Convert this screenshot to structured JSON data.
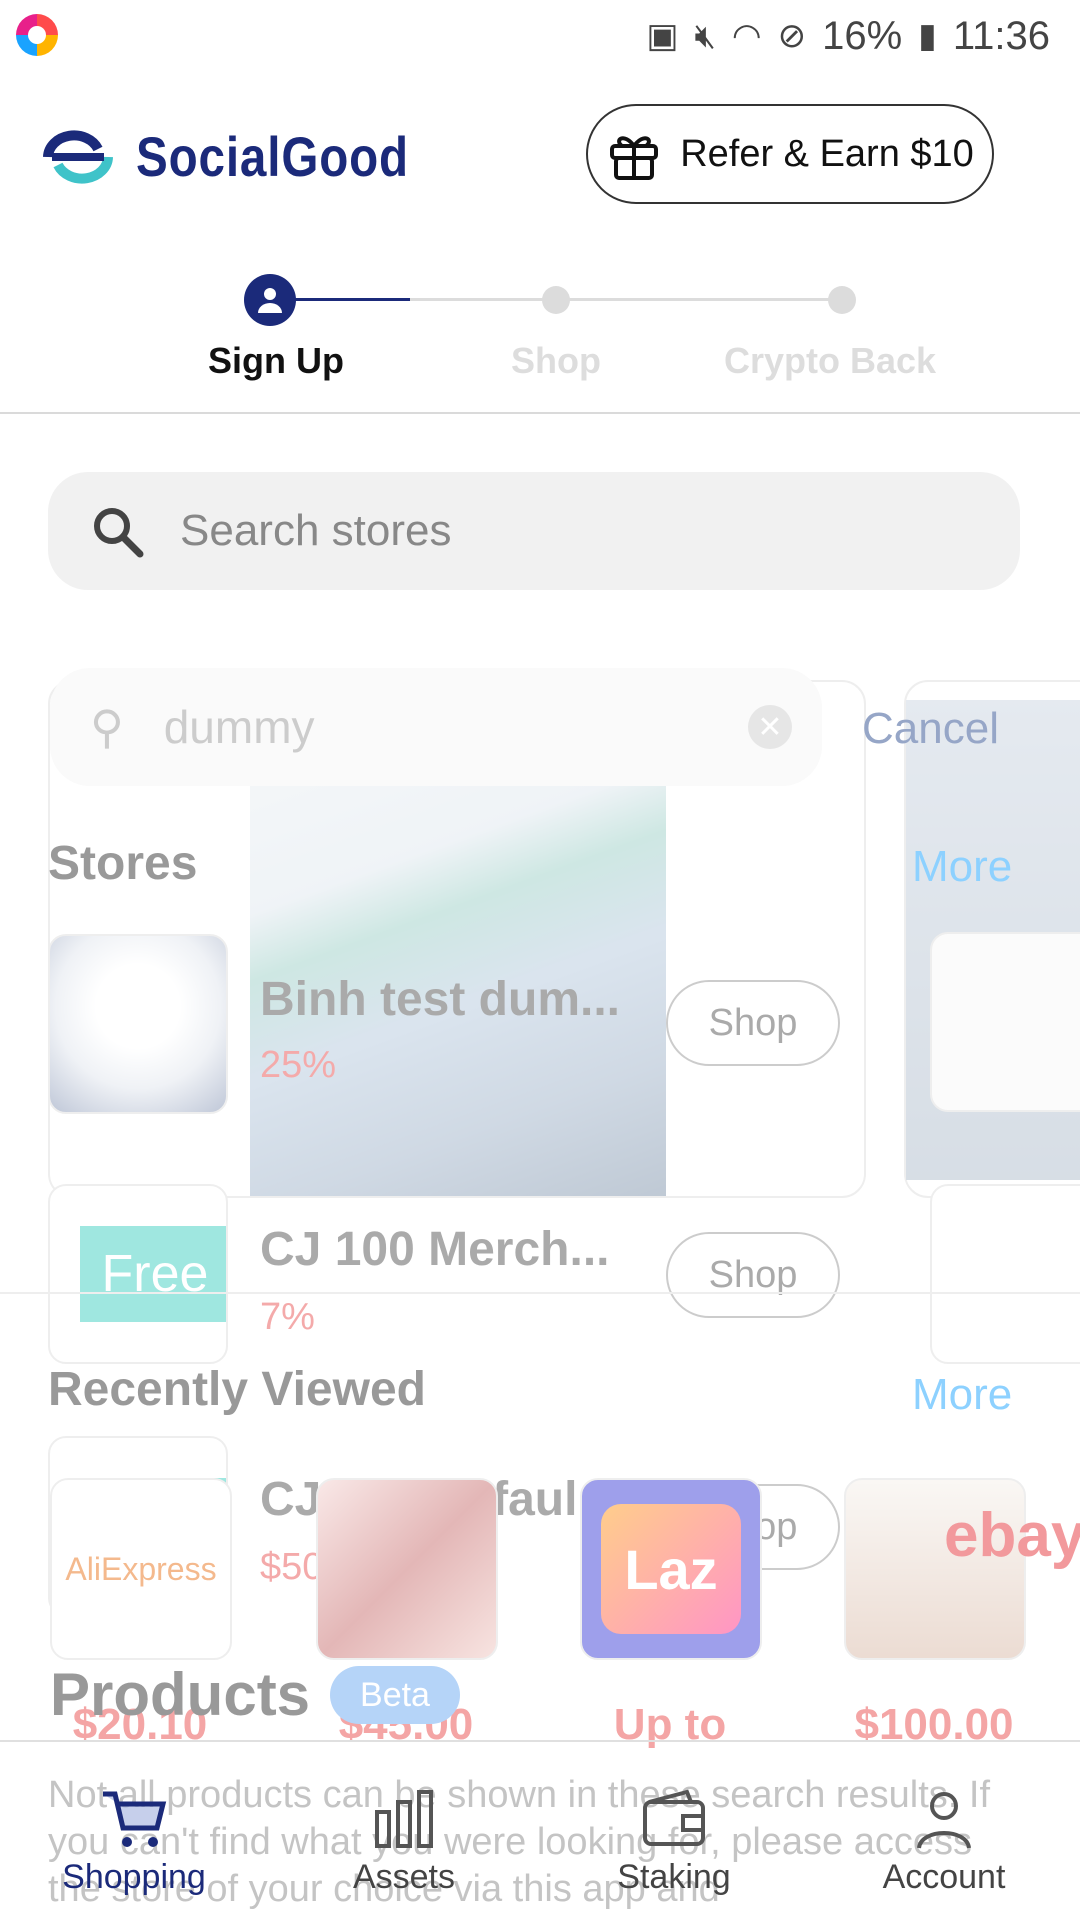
{
  "status_bar": {
    "battery": "16%",
    "time": "11:36"
  },
  "header": {
    "brand": "SocialGood",
    "refer_label": "Refer & Earn $10"
  },
  "stepper": {
    "steps": [
      {
        "label": "Sign Up"
      },
      {
        "label": "Shop"
      },
      {
        "label": "Crypto Back"
      }
    ]
  },
  "search": {
    "placeholder": "Search stores"
  },
  "overlay": {
    "query": "dummy",
    "cancel": "Cancel",
    "stores_title": "Stores",
    "more": "More",
    "stores": [
      {
        "name": "Binh test dum...",
        "rate": "25%",
        "shop": "Shop"
      },
      {
        "name": "CJ 100 Merch...",
        "rate": "7%",
        "shop": "Shop"
      },
      {
        "name": "CJ Eba defaul...",
        "rate": "$50.00",
        "shop": "Shop"
      }
    ],
    "recently_viewed_title": "Recently Viewed",
    "recently_more": "More",
    "recent_products": [
      {
        "logo": "AliExpress",
        "price": "$20.10"
      },
      {
        "price": "$45.00"
      },
      {
        "logo": "Laz",
        "price": "Up to"
      },
      {
        "price": "$100.00"
      }
    ],
    "free_badge": "Free",
    "ebay_logo": "ebay",
    "products_title": "Products",
    "beta": "Beta",
    "note": "Not all products can be shown in these search results. If you can't find what you were looking for, please access the store of your choice via this app and"
  },
  "nav": [
    {
      "label": "Shopping",
      "icon": "cart-icon",
      "active": true
    },
    {
      "label": "Assets",
      "icon": "bar-chart-icon"
    },
    {
      "label": "Staking",
      "icon": "wallet-icon"
    },
    {
      "label": "Account",
      "icon": "person-icon"
    }
  ],
  "colors": {
    "brand": "#1b2a7a",
    "accent": "#1aa3ff",
    "price": "#e84a4a"
  }
}
